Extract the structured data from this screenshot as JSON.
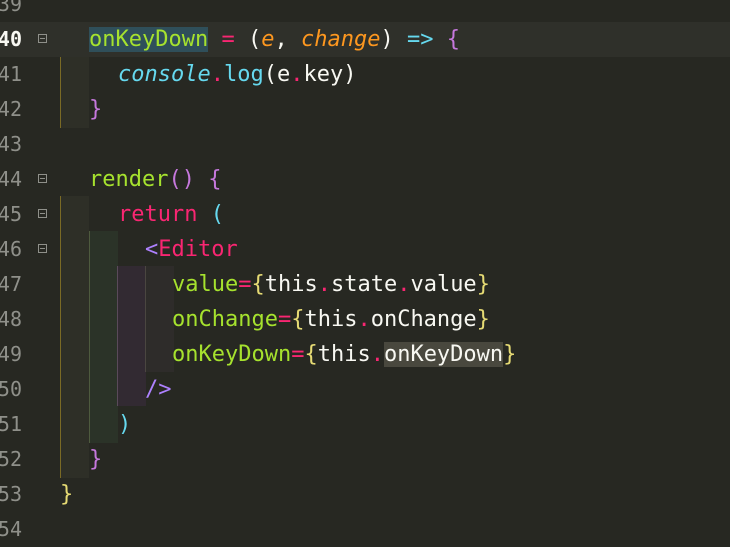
{
  "editor": {
    "lines": [
      {
        "number": "39"
      },
      {
        "number": "40",
        "segments": [
          "onKeyDown",
          " = ",
          "(",
          "e",
          ", ",
          "change",
          ")",
          " => ",
          "{"
        ]
      },
      {
        "number": "41",
        "segments": [
          "console",
          ".",
          "log",
          "(",
          "e",
          ".",
          "key",
          ")"
        ]
      },
      {
        "number": "42",
        "segments": [
          "}"
        ]
      },
      {
        "number": "43"
      },
      {
        "number": "44",
        "segments": [
          "render",
          "() ",
          "{"
        ]
      },
      {
        "number": "45",
        "segments": [
          "return",
          " ",
          "("
        ]
      },
      {
        "number": "46",
        "segments": [
          "<",
          "Editor"
        ]
      },
      {
        "number": "47",
        "segments": [
          "value",
          "=",
          "{",
          "this",
          ".",
          "state",
          ".",
          "value",
          "}"
        ]
      },
      {
        "number": "48",
        "segments": [
          "onChange",
          "=",
          "{",
          "this",
          ".",
          "onChange",
          "}"
        ]
      },
      {
        "number": "49",
        "segments": [
          "onKeyDown",
          "=",
          "{",
          "this",
          ".",
          "onKeyDown",
          "}"
        ]
      },
      {
        "number": "50",
        "segments": [
          "/>"
        ]
      },
      {
        "number": "51",
        "segments": [
          ")"
        ]
      },
      {
        "number": "52",
        "segments": [
          "}"
        ]
      },
      {
        "number": "53",
        "segments": [
          "}"
        ]
      },
      {
        "number": "54"
      }
    ]
  }
}
